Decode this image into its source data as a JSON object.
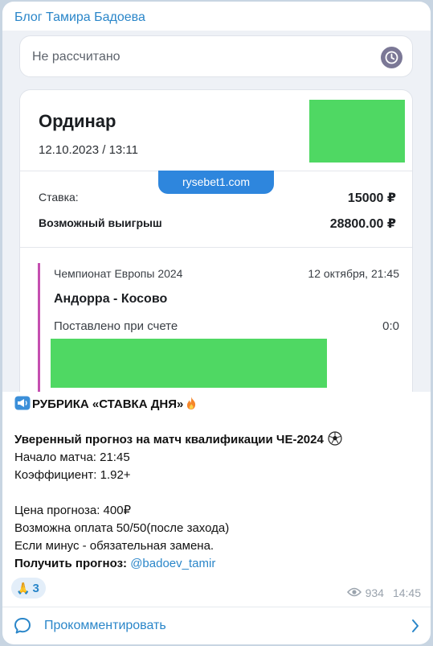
{
  "channel": {
    "name": "Блог Тамира Бадоева"
  },
  "screenshot": {
    "status": "Не рассчитано",
    "bet_type": "Ординар",
    "bet_datetime": "12.10.2023 / 13:11",
    "watermark": "rysebet1.com",
    "stake_label": "Ставка:",
    "stake_value": "15000 ₽",
    "win_label": "Возможный выигрыш",
    "win_value": "28800.00 ₽",
    "event": {
      "league": "Чемпионат Европы 2024",
      "date": "12 октября, 21:45",
      "teams": "Андорра - Косово",
      "placed_label": "Поставлено при счете",
      "score": "0:0"
    },
    "colors": {
      "accent_stripe": "#c54fb0",
      "redaction": "#4fd863",
      "watermark_bg": "#2e86dd"
    }
  },
  "message": {
    "rubric": "РУБРИКА «СТАВКА ДНЯ»",
    "rubric_icons": [
      "megaphone-icon",
      "fire-icon"
    ],
    "headline": "Уверенный прогноз на матч квалификации ЧЕ-2024",
    "headline_icon": "soccer-ball-icon",
    "start": "Начало матча: 21:45",
    "coef": "Коэффициент: 1.92+",
    "price": "Цена прогноза: 400₽",
    "payment": "Возможна оплата 50/50(после захода)",
    "minus": "Если минус - обязательная замена.",
    "get_label": "Получить прогноз:",
    "get_link": "@badoev_tamir"
  },
  "reaction": {
    "emoji": "🙏",
    "count": "3"
  },
  "meta": {
    "views": "934",
    "time": "14:45"
  },
  "comments": {
    "label": "Прокомментировать"
  }
}
